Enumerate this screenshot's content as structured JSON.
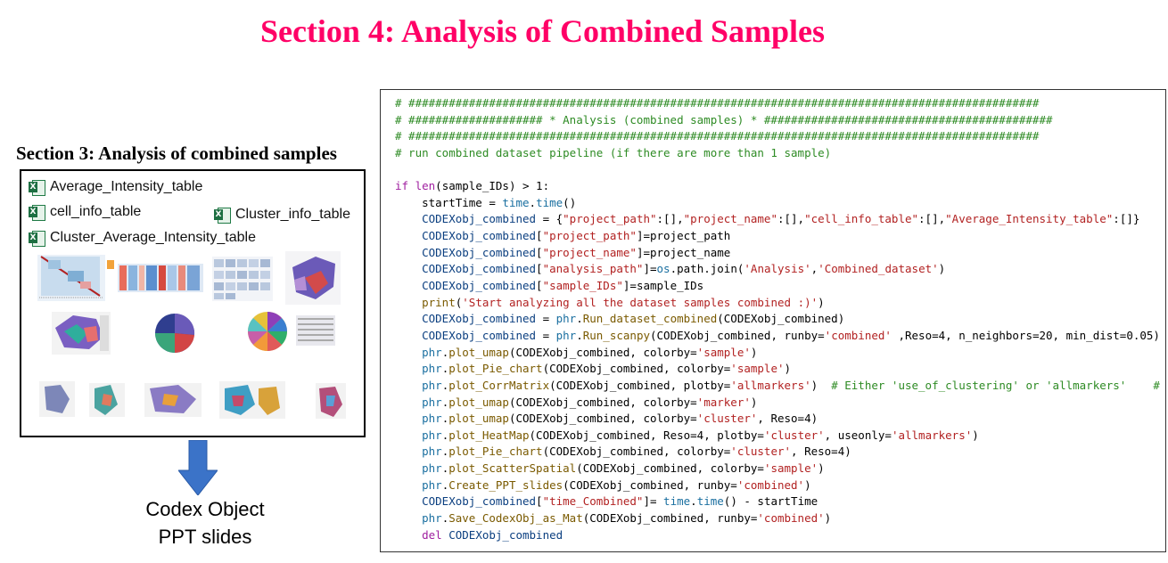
{
  "page": {
    "title": "Section 4: Analysis of Combined Samples",
    "section3_title": "Section 3: Analysis of combined samples",
    "output_label_line1": "Codex Object",
    "output_label_line2": "PPT slides"
  },
  "files": [
    {
      "name": "Average_Intensity_table",
      "icon": "excel-icon"
    },
    {
      "name": "cell_info_table",
      "icon": "excel-icon"
    },
    {
      "name": "Cluster_info_table",
      "icon": "excel-icon"
    },
    {
      "name": "Cluster_Average_Intensity_table",
      "icon": "excel-icon"
    }
  ],
  "colors": {
    "title": "#ff0066",
    "comment": "#2e8b24",
    "keyword": "#a020a0",
    "string": "#b22222",
    "arrow": "#3b73c8"
  },
  "code_lines": [
    [
      [
        "comment",
        "# ##############################################################################################"
      ]
    ],
    [
      [
        "comment",
        "# #################### * Analysis (combined samples) * ###########################################"
      ]
    ],
    [
      [
        "comment",
        "# ##############################################################################################"
      ]
    ],
    [
      [
        "comment",
        "# run combined dataset pipeline (if there are more than 1 sample)"
      ]
    ],
    [
      [
        "plain",
        ""
      ]
    ],
    [
      [
        "kw",
        "if"
      ],
      [
        "plain",
        " "
      ],
      [
        "kw",
        "len"
      ],
      [
        "plain",
        "(sample_IDs) > 1:"
      ]
    ],
    [
      [
        "plain",
        "    startTime = "
      ],
      [
        "mod",
        "time"
      ],
      [
        "plain",
        "."
      ],
      [
        "mod",
        "time"
      ],
      [
        "plain",
        "()"
      ]
    ],
    [
      [
        "plain",
        "    "
      ],
      [
        "id",
        "CODEXobj_combined"
      ],
      [
        "plain",
        " = {"
      ],
      [
        "str",
        "\"project_path\""
      ],
      [
        "plain",
        ":[],"
      ],
      [
        "str",
        "\"project_name\""
      ],
      [
        "plain",
        ":[],"
      ],
      [
        "str",
        "\"cell_info_table\""
      ],
      [
        "plain",
        ":[],"
      ],
      [
        "str",
        "\"Average_Intensity_table\""
      ],
      [
        "plain",
        ":[]}"
      ]
    ],
    [
      [
        "plain",
        "    "
      ],
      [
        "id",
        "CODEXobj_combined"
      ],
      [
        "plain",
        "["
      ],
      [
        "str",
        "\"project_path\""
      ],
      [
        "plain",
        "]=project_path"
      ]
    ],
    [
      [
        "plain",
        "    "
      ],
      [
        "id",
        "CODEXobj_combined"
      ],
      [
        "plain",
        "["
      ],
      [
        "str",
        "\"project_name\""
      ],
      [
        "plain",
        "]=project_name"
      ]
    ],
    [
      [
        "plain",
        "    "
      ],
      [
        "id",
        "CODEXobj_combined"
      ],
      [
        "plain",
        "["
      ],
      [
        "str",
        "\"analysis_path\""
      ],
      [
        "plain",
        "]="
      ],
      [
        "mod",
        "os"
      ],
      [
        "plain",
        ".path.join("
      ],
      [
        "str",
        "'Analysis'"
      ],
      [
        "plain",
        ","
      ],
      [
        "str",
        "'Combined_dataset'"
      ],
      [
        "plain",
        ")"
      ]
    ],
    [
      [
        "plain",
        "    "
      ],
      [
        "id",
        "CODEXobj_combined"
      ],
      [
        "plain",
        "["
      ],
      [
        "str",
        "\"sample_IDs\""
      ],
      [
        "plain",
        "]=sample_IDs"
      ]
    ],
    [
      [
        "plain",
        "    "
      ],
      [
        "fn",
        "print"
      ],
      [
        "plain",
        "("
      ],
      [
        "str",
        "'Start analyzing all the dataset samples combined :)'"
      ],
      [
        "plain",
        ")"
      ]
    ],
    [
      [
        "plain",
        "    "
      ],
      [
        "id",
        "CODEXobj_combined"
      ],
      [
        "plain",
        " = "
      ],
      [
        "mod",
        "phr"
      ],
      [
        "plain",
        "."
      ],
      [
        "fn",
        "Run_dataset_combined"
      ],
      [
        "plain",
        "(CODEXobj_combined)"
      ]
    ],
    [
      [
        "plain",
        "    "
      ],
      [
        "id",
        "CODEXobj_combined"
      ],
      [
        "plain",
        " = "
      ],
      [
        "mod",
        "phr"
      ],
      [
        "plain",
        "."
      ],
      [
        "fn",
        "Run_scanpy"
      ],
      [
        "plain",
        "(CODEXobj_combined, runby="
      ],
      [
        "str",
        "'combined'"
      ],
      [
        "plain",
        " ,Reso=4, n_neighbors=20, min_dist=0.05)"
      ]
    ],
    [
      [
        "plain",
        "    "
      ],
      [
        "mod",
        "phr"
      ],
      [
        "plain",
        "."
      ],
      [
        "fn",
        "plot_umap"
      ],
      [
        "plain",
        "(CODEXobj_combined, colorby="
      ],
      [
        "str",
        "'sample'"
      ],
      [
        "plain",
        ")"
      ]
    ],
    [
      [
        "plain",
        "    "
      ],
      [
        "mod",
        "phr"
      ],
      [
        "plain",
        "."
      ],
      [
        "fn",
        "plot_Pie_chart"
      ],
      [
        "plain",
        "(CODEXobj_combined, colorby="
      ],
      [
        "str",
        "'sample'"
      ],
      [
        "plain",
        ")"
      ]
    ],
    [
      [
        "plain",
        "    "
      ],
      [
        "mod",
        "phr"
      ],
      [
        "plain",
        "."
      ],
      [
        "fn",
        "plot_CorrMatrix"
      ],
      [
        "plain",
        "(CODEXobj_combined, plotby="
      ],
      [
        "str",
        "'allmarkers'"
      ],
      [
        "plain",
        ")  "
      ],
      [
        "comment",
        "# Either 'use_of_clustering' or 'allmarkers'    #"
      ]
    ],
    [
      [
        "plain",
        "    "
      ],
      [
        "mod",
        "phr"
      ],
      [
        "plain",
        "."
      ],
      [
        "fn",
        "plot_umap"
      ],
      [
        "plain",
        "(CODEXobj_combined, colorby="
      ],
      [
        "str",
        "'marker'"
      ],
      [
        "plain",
        ")"
      ]
    ],
    [
      [
        "plain",
        "    "
      ],
      [
        "mod",
        "phr"
      ],
      [
        "plain",
        "."
      ],
      [
        "fn",
        "plot_umap"
      ],
      [
        "plain",
        "(CODEXobj_combined, colorby="
      ],
      [
        "str",
        "'cluster'"
      ],
      [
        "plain",
        ", Reso=4)"
      ]
    ],
    [
      [
        "plain",
        "    "
      ],
      [
        "mod",
        "phr"
      ],
      [
        "plain",
        "."
      ],
      [
        "fn",
        "plot_HeatMap"
      ],
      [
        "plain",
        "(CODEXobj_combined, Reso=4, plotby="
      ],
      [
        "str",
        "'cluster'"
      ],
      [
        "plain",
        ", useonly="
      ],
      [
        "str",
        "'allmarkers'"
      ],
      [
        "plain",
        ")"
      ]
    ],
    [
      [
        "plain",
        "    "
      ],
      [
        "mod",
        "phr"
      ],
      [
        "plain",
        "."
      ],
      [
        "fn",
        "plot_Pie_chart"
      ],
      [
        "plain",
        "(CODEXobj_combined, colorby="
      ],
      [
        "str",
        "'cluster'"
      ],
      [
        "plain",
        ", Reso=4)"
      ]
    ],
    [
      [
        "plain",
        "    "
      ],
      [
        "mod",
        "phr"
      ],
      [
        "plain",
        "."
      ],
      [
        "fn",
        "plot_ScatterSpatial"
      ],
      [
        "plain",
        "(CODEXobj_combined, colorby="
      ],
      [
        "str",
        "'sample'"
      ],
      [
        "plain",
        ")"
      ]
    ],
    [
      [
        "plain",
        "    "
      ],
      [
        "mod",
        "phr"
      ],
      [
        "plain",
        "."
      ],
      [
        "fn",
        "Create_PPT_slides"
      ],
      [
        "plain",
        "(CODEXobj_combined, runby="
      ],
      [
        "str",
        "'combined'"
      ],
      [
        "plain",
        ")"
      ]
    ],
    [
      [
        "plain",
        "    "
      ],
      [
        "id",
        "CODEXobj_combined"
      ],
      [
        "plain",
        "["
      ],
      [
        "str",
        "\"time_Combined\""
      ],
      [
        "plain",
        "]= "
      ],
      [
        "mod",
        "time"
      ],
      [
        "plain",
        "."
      ],
      [
        "mod",
        "time"
      ],
      [
        "plain",
        "() - startTime"
      ]
    ],
    [
      [
        "plain",
        "    "
      ],
      [
        "mod",
        "phr"
      ],
      [
        "plain",
        "."
      ],
      [
        "fn",
        "Save_CodexObj_as_Mat"
      ],
      [
        "plain",
        "(CODEXobj_combined, runby="
      ],
      [
        "str",
        "'combined'"
      ],
      [
        "plain",
        ")"
      ]
    ],
    [
      [
        "plain",
        "    "
      ],
      [
        "kw",
        "del"
      ],
      [
        "plain",
        " "
      ],
      [
        "id",
        "CODEXobj_combined"
      ]
    ]
  ]
}
